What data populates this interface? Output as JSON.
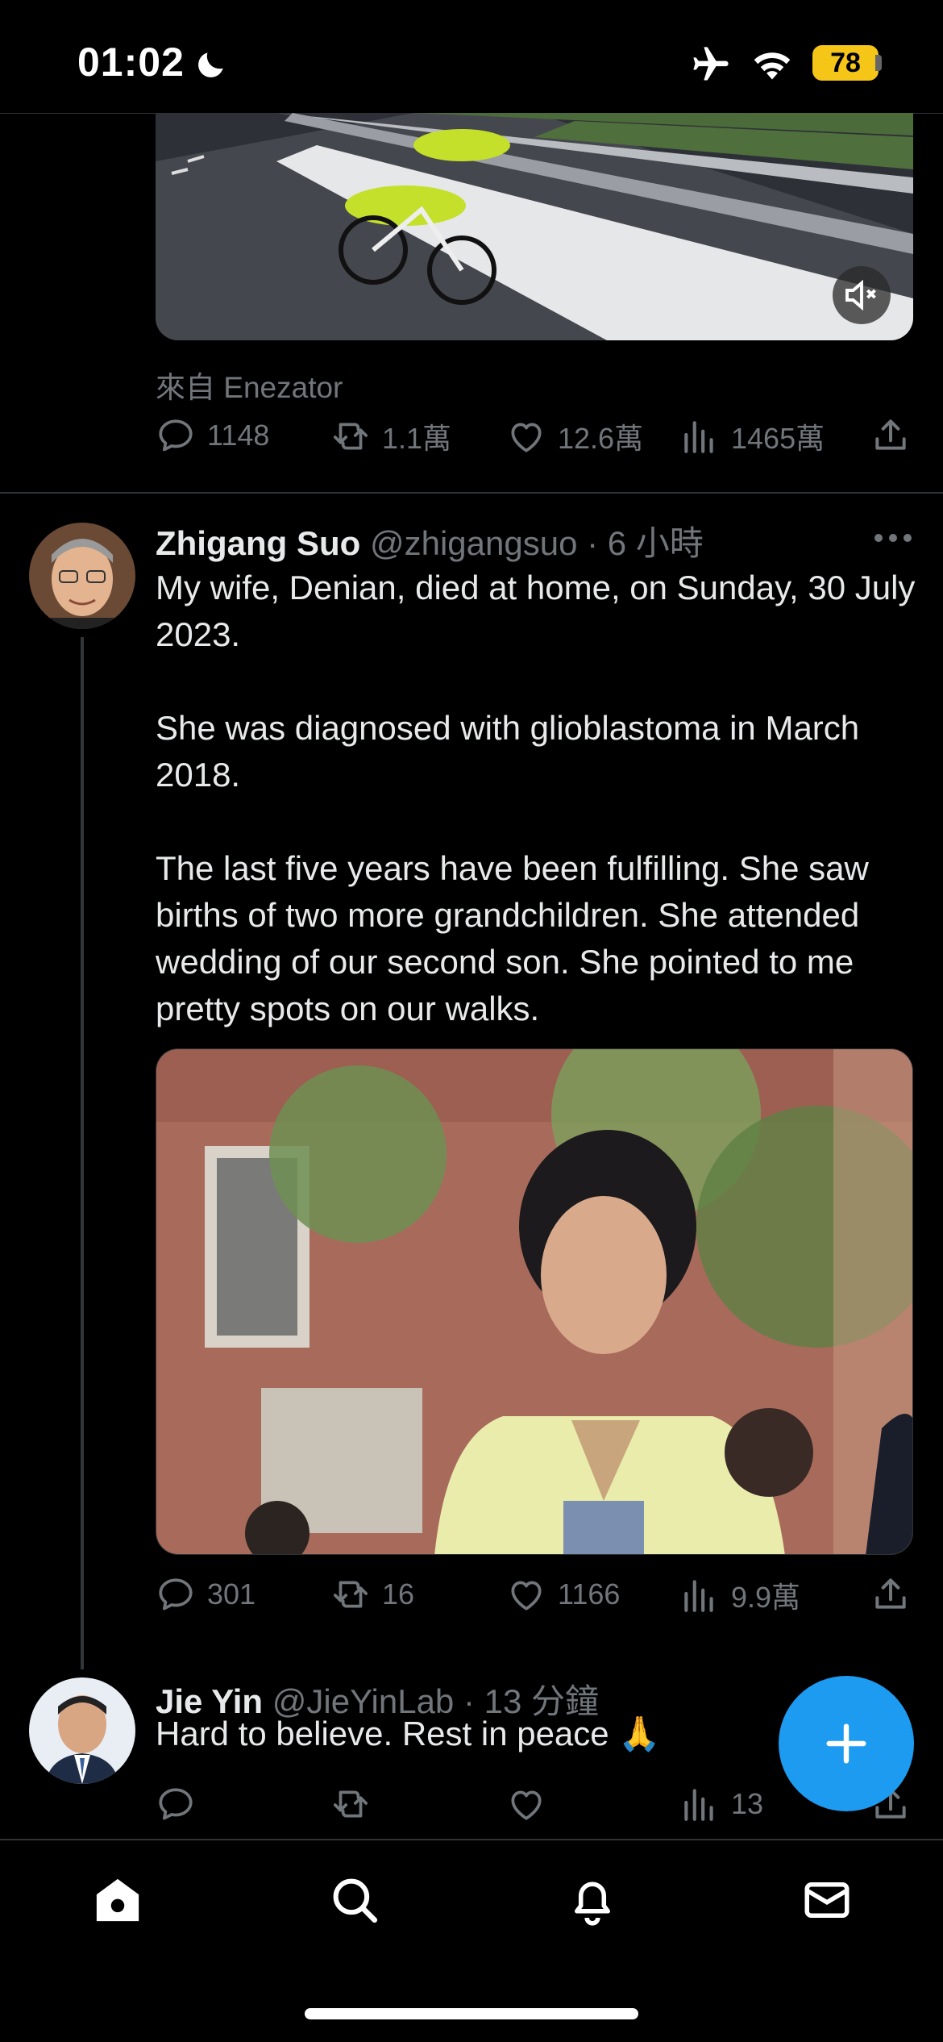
{
  "status_bar": {
    "time": "01:02",
    "battery": "78"
  },
  "top_tweet": {
    "source": "來自 Enezator",
    "replies": "1148",
    "retweets": "1.1萬",
    "likes": "12.6萬",
    "views": "1465萬"
  },
  "main_tweet": {
    "author_name": "Zhigang Suo",
    "handle_time": "@zhigangsuo · 6 小時",
    "paragraphs": [
      "My wife, Denian, died at home, on Sunday, 30 July 2023.",
      "She was diagnosed with glioblastoma in March 2018.",
      "The last five years have been fulfilling. She saw births of two more grandchildren. She attended wedding of our second son. She pointed to me pretty spots on our walks."
    ],
    "replies": "301",
    "retweets": "16",
    "likes": "1166",
    "views": "9.9萬"
  },
  "reply_tweet": {
    "author_name": "Jie Yin",
    "handle_time": "@JieYinLab · 13 分鐘",
    "text": "Hard to believe. Rest in peace 🙏",
    "views": "13"
  },
  "icons": {
    "reply": "speech-bubble-icon",
    "retweet": "retweet-icon",
    "like": "heart-icon",
    "views": "bar-chart-icon",
    "share": "share-icon",
    "fab": "plus-icon",
    "nav": [
      "home-icon",
      "search-icon",
      "bell-icon",
      "mail-icon"
    ]
  },
  "colors": {
    "accent": "#1d9bf0",
    "muted": "#71767b",
    "text": "#e7e9ea",
    "battery": "#f5c518"
  }
}
